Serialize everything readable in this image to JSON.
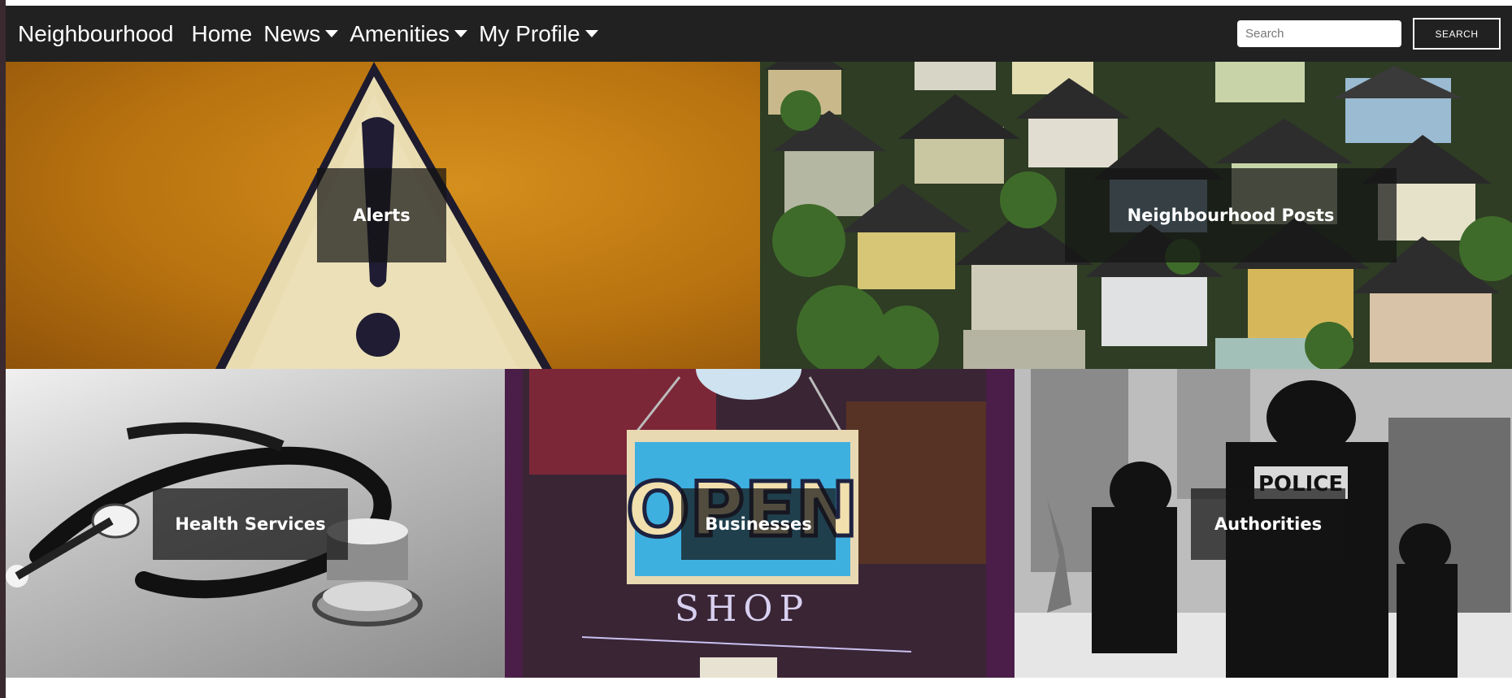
{
  "navbar": {
    "brand": "Neighbourhood",
    "items": [
      {
        "label": "Home",
        "dropdown": false
      },
      {
        "label": "News",
        "dropdown": true
      },
      {
        "label": "Amenities",
        "dropdown": true
      },
      {
        "label": "My Profile",
        "dropdown": true
      }
    ],
    "search": {
      "placeholder": "Search",
      "button_label": "SEARCH"
    }
  },
  "tiles": {
    "alerts": "Alerts",
    "posts": "Neighbourhood Posts",
    "health": "Health Services",
    "business": "Businesses",
    "authorities": "Authorities"
  },
  "images": {
    "business_sign": "OPEN",
    "business_shop": "SHOP",
    "police_vest": "POLICE"
  },
  "colors": {
    "navbar_bg": "#212121",
    "label_overlay": "rgba(20,20,20,0.72)"
  }
}
